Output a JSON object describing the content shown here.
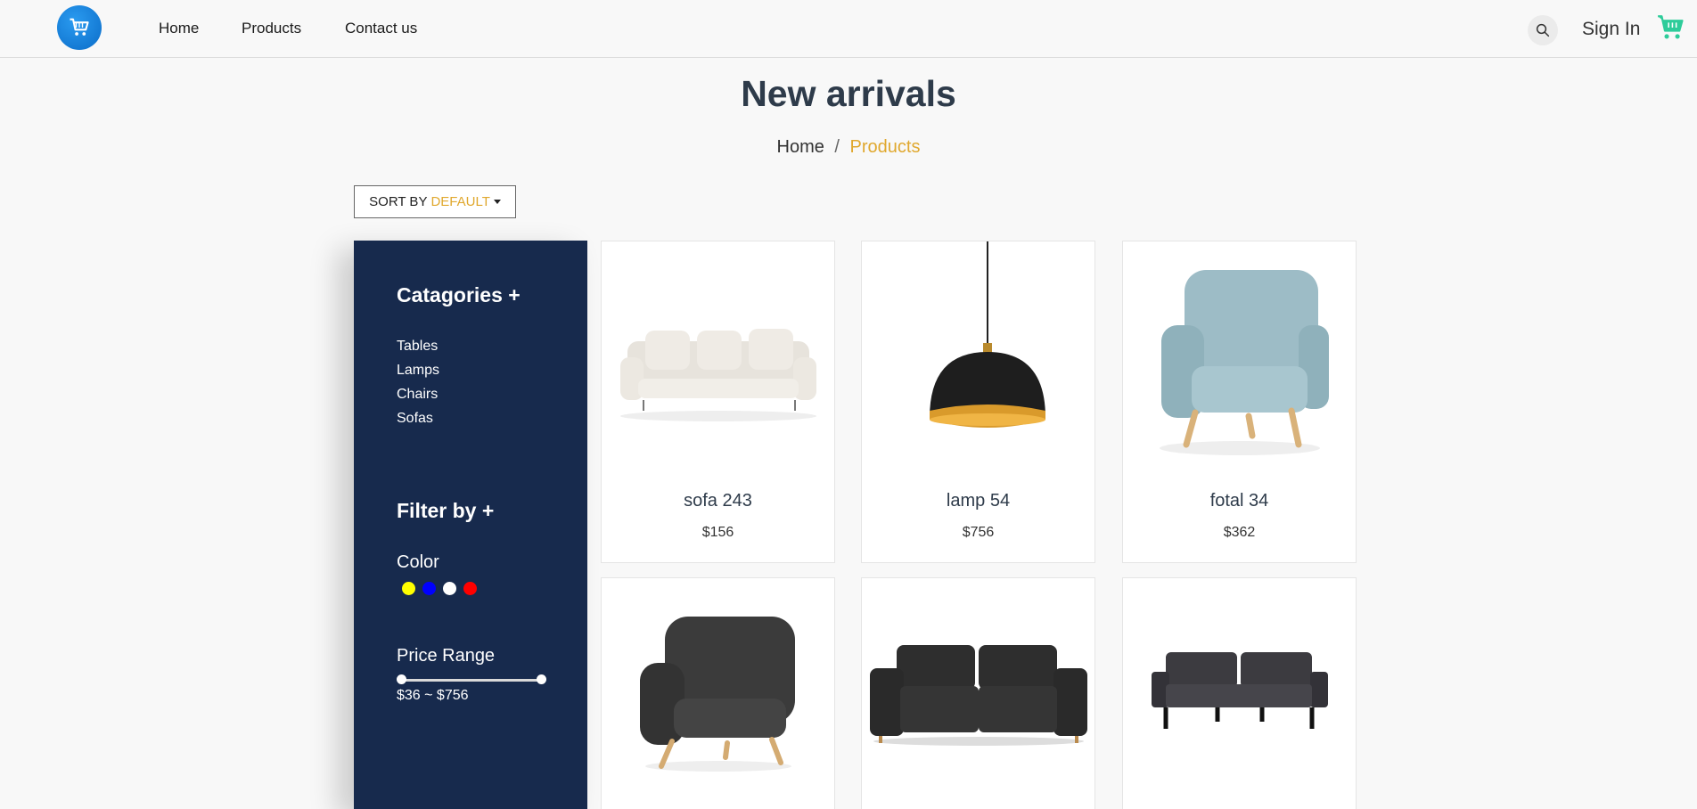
{
  "nav": {
    "links": [
      "Home",
      "Products",
      "Contact us"
    ],
    "sign_in": "Sign In"
  },
  "page": {
    "title": "New arrivals",
    "breadcrumb": {
      "home": "Home",
      "separator": "/",
      "current": "Products"
    }
  },
  "sort": {
    "label": "SORT BY",
    "value": "DEFAULT"
  },
  "sidebar": {
    "categories_heading": "Catagories +",
    "categories": [
      "Tables",
      "Lamps",
      "Chairs",
      "Sofas"
    ],
    "filter_heading": "Filter by +",
    "color_label": "Color",
    "colors": [
      "#ffff00",
      "#0000ff",
      "#ffffff",
      "#ff0000"
    ],
    "price_label": "Price Range",
    "price_range": "$36 ~ $756"
  },
  "products": [
    {
      "name": "sofa 243",
      "price": "$156"
    },
    {
      "name": "lamp 54",
      "price": "$756"
    },
    {
      "name": "fotal 34",
      "price": "$362"
    },
    {
      "name": "",
      "price": ""
    },
    {
      "name": "",
      "price": ""
    },
    {
      "name": "",
      "price": ""
    }
  ],
  "colors": {
    "accent": "#e0a82e",
    "sidebar_bg": "#172a4d",
    "cart_icon": "#2ecc9a"
  }
}
